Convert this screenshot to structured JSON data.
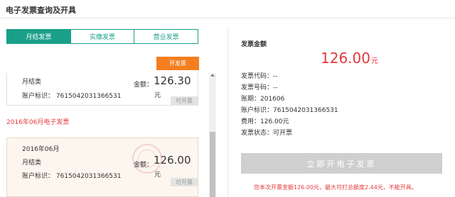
{
  "page": {
    "title": "电子发票查询及开具"
  },
  "tabs": [
    {
      "label": "月结发票",
      "active": true
    },
    {
      "label": "实缴发票",
      "active": false
    },
    {
      "label": "营业发票",
      "active": false
    }
  ],
  "toolbar": {
    "issue_label": "开发票"
  },
  "invoices": {
    "first": {
      "type": "月结类",
      "amount_label": "金额：",
      "amount": "126.30",
      "unit": "元",
      "account": "账户标识： 7615042031366531",
      "status": "可开票"
    },
    "month_heading": "2016年06月电子发票",
    "second": {
      "month": "2016年06月",
      "type": "月结类",
      "amount_label": "金额：",
      "amount": "126.00",
      "unit": "元",
      "account": "账户标识： 7615042031366531",
      "status": "可开票"
    }
  },
  "detail": {
    "title": "发票金额",
    "amount": "126.00",
    "unit": "元",
    "rows": [
      "发票代码：--",
      "发票号码：--",
      "账期：201606",
      "账户标识：7615042031366531",
      "费用：126.00元",
      "发票状态：可开票"
    ],
    "apply_label": "立即开电子发票",
    "notice": "您本次开票金额126.00元，最大可打总额度2.44元，不能开具。"
  },
  "colors": {
    "accent": "#1aa089",
    "orange": "#f57f20",
    "red": "#e4393c"
  }
}
